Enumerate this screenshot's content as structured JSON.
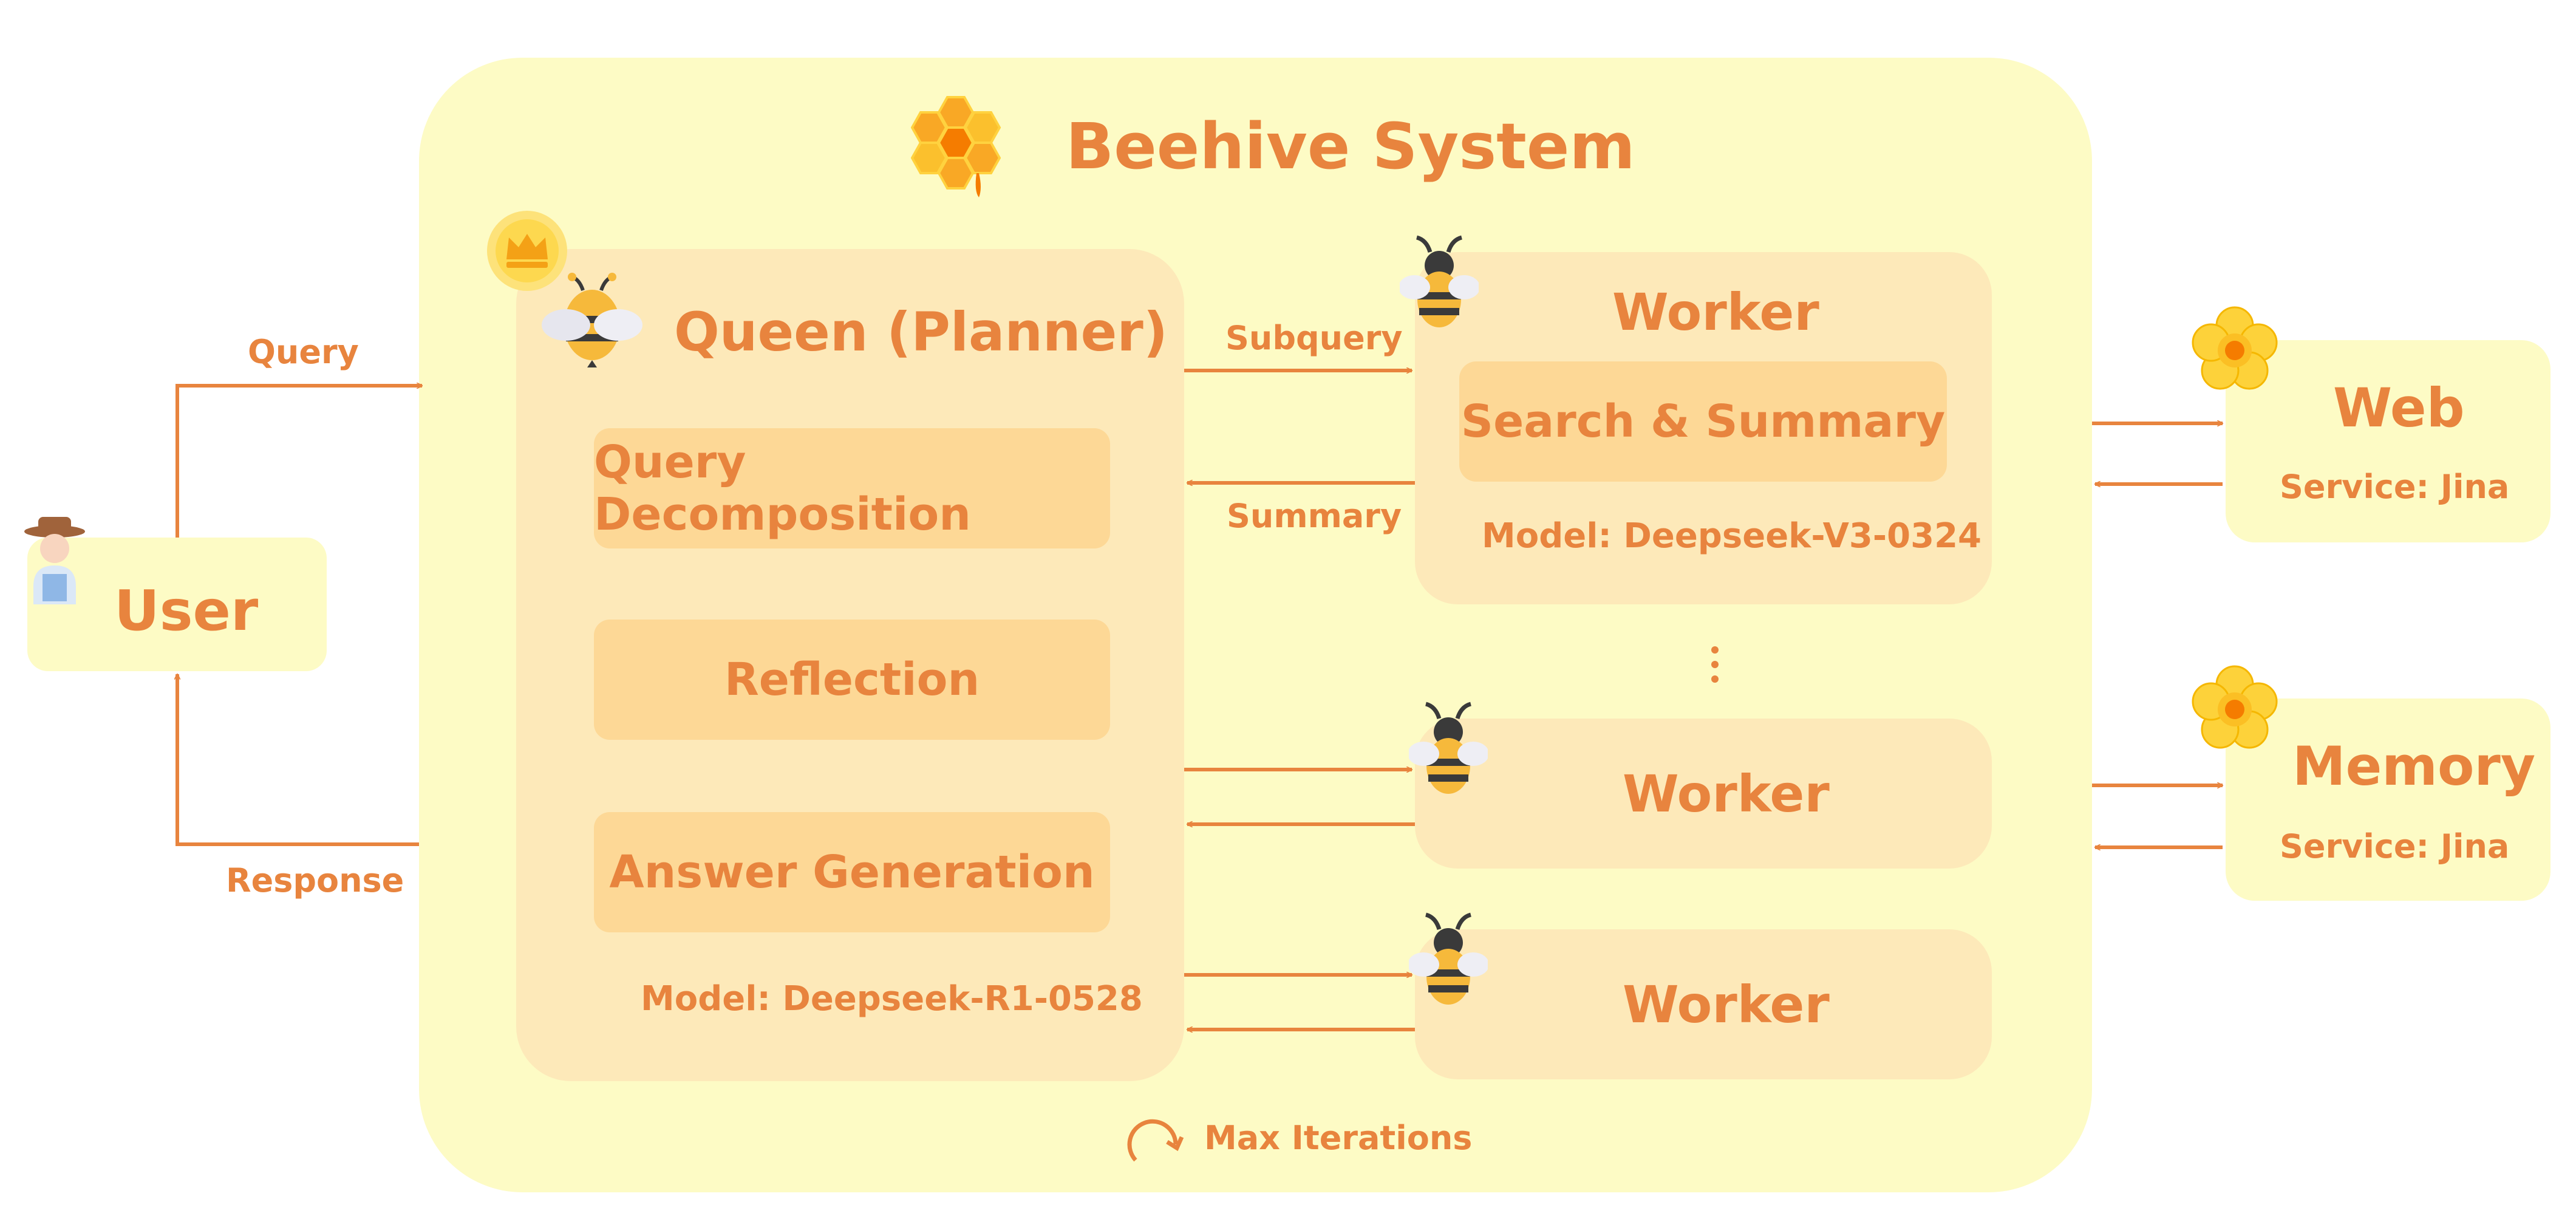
{
  "system": {
    "title": "Beehive System",
    "loop_label": "Max Iterations"
  },
  "user": {
    "label": "User",
    "query_label": "Query",
    "response_label": "Response"
  },
  "queen": {
    "title": "Queen (Planner)",
    "steps": [
      "Query Decomposition",
      "Reflection",
      "Answer Generation"
    ],
    "model": "Model: Deepseek-R1-0528"
  },
  "edges": {
    "subquery": "Subquery",
    "summary": "Summary"
  },
  "workers": [
    {
      "title": "Worker",
      "task": "Search & Summary",
      "model": "Model: Deepseek-V3-0324"
    },
    {
      "title": "Worker"
    },
    {
      "title": "Worker"
    }
  ],
  "services": [
    {
      "title": "Web",
      "detail": "Service: Jina"
    },
    {
      "title": "Memory",
      "detail": "Service: Jina"
    }
  ],
  "colors": {
    "accent": "#e8843e",
    "system_bg": "#fdfbc5",
    "panel_bg": "#fde9b9",
    "button_bg": "#fdd896",
    "bee_yellow": "#f6b93b",
    "flower_yellow": "#fdd23a"
  }
}
